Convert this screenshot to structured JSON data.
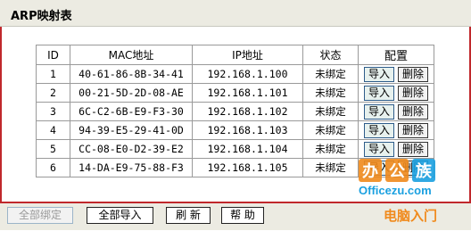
{
  "title": "ARP映射表",
  "table": {
    "headers": {
      "id": "ID",
      "mac": "MAC地址",
      "ip": "IP地址",
      "state": "状态",
      "config": "配置"
    },
    "import_label": "导入",
    "delete_label": "删除",
    "rows": [
      {
        "id": "1",
        "mac": "40-61-86-8B-34-41",
        "ip": "192.168.1.100",
        "state": "未绑定"
      },
      {
        "id": "2",
        "mac": "00-21-5D-2D-08-AE",
        "ip": "192.168.1.101",
        "state": "未绑定"
      },
      {
        "id": "3",
        "mac": "6C-C2-6B-E9-F3-30",
        "ip": "192.168.1.102",
        "state": "未绑定"
      },
      {
        "id": "4",
        "mac": "94-39-E5-29-41-0D",
        "ip": "192.168.1.103",
        "state": "未绑定"
      },
      {
        "id": "5",
        "mac": "CC-08-E0-D2-39-E2",
        "ip": "192.168.1.104",
        "state": "未绑定"
      },
      {
        "id": "6",
        "mac": "14-DA-E9-75-88-F3",
        "ip": "192.168.1.105",
        "state": "未绑定"
      }
    ]
  },
  "toolbar": {
    "bind_all": "全部绑定",
    "import_all": "全部导入",
    "refresh": "刷 新",
    "help": "帮 助"
  },
  "watermark": {
    "brand_chars": "办公族",
    "domain": "Officezu.com",
    "tagline": "电脑入门"
  },
  "colors": {
    "frame_border": "#c0282c",
    "bar_bg": "#ecebe2",
    "watermark_orange": "#f08a1c",
    "watermark_blue": "#1aa0e0"
  }
}
